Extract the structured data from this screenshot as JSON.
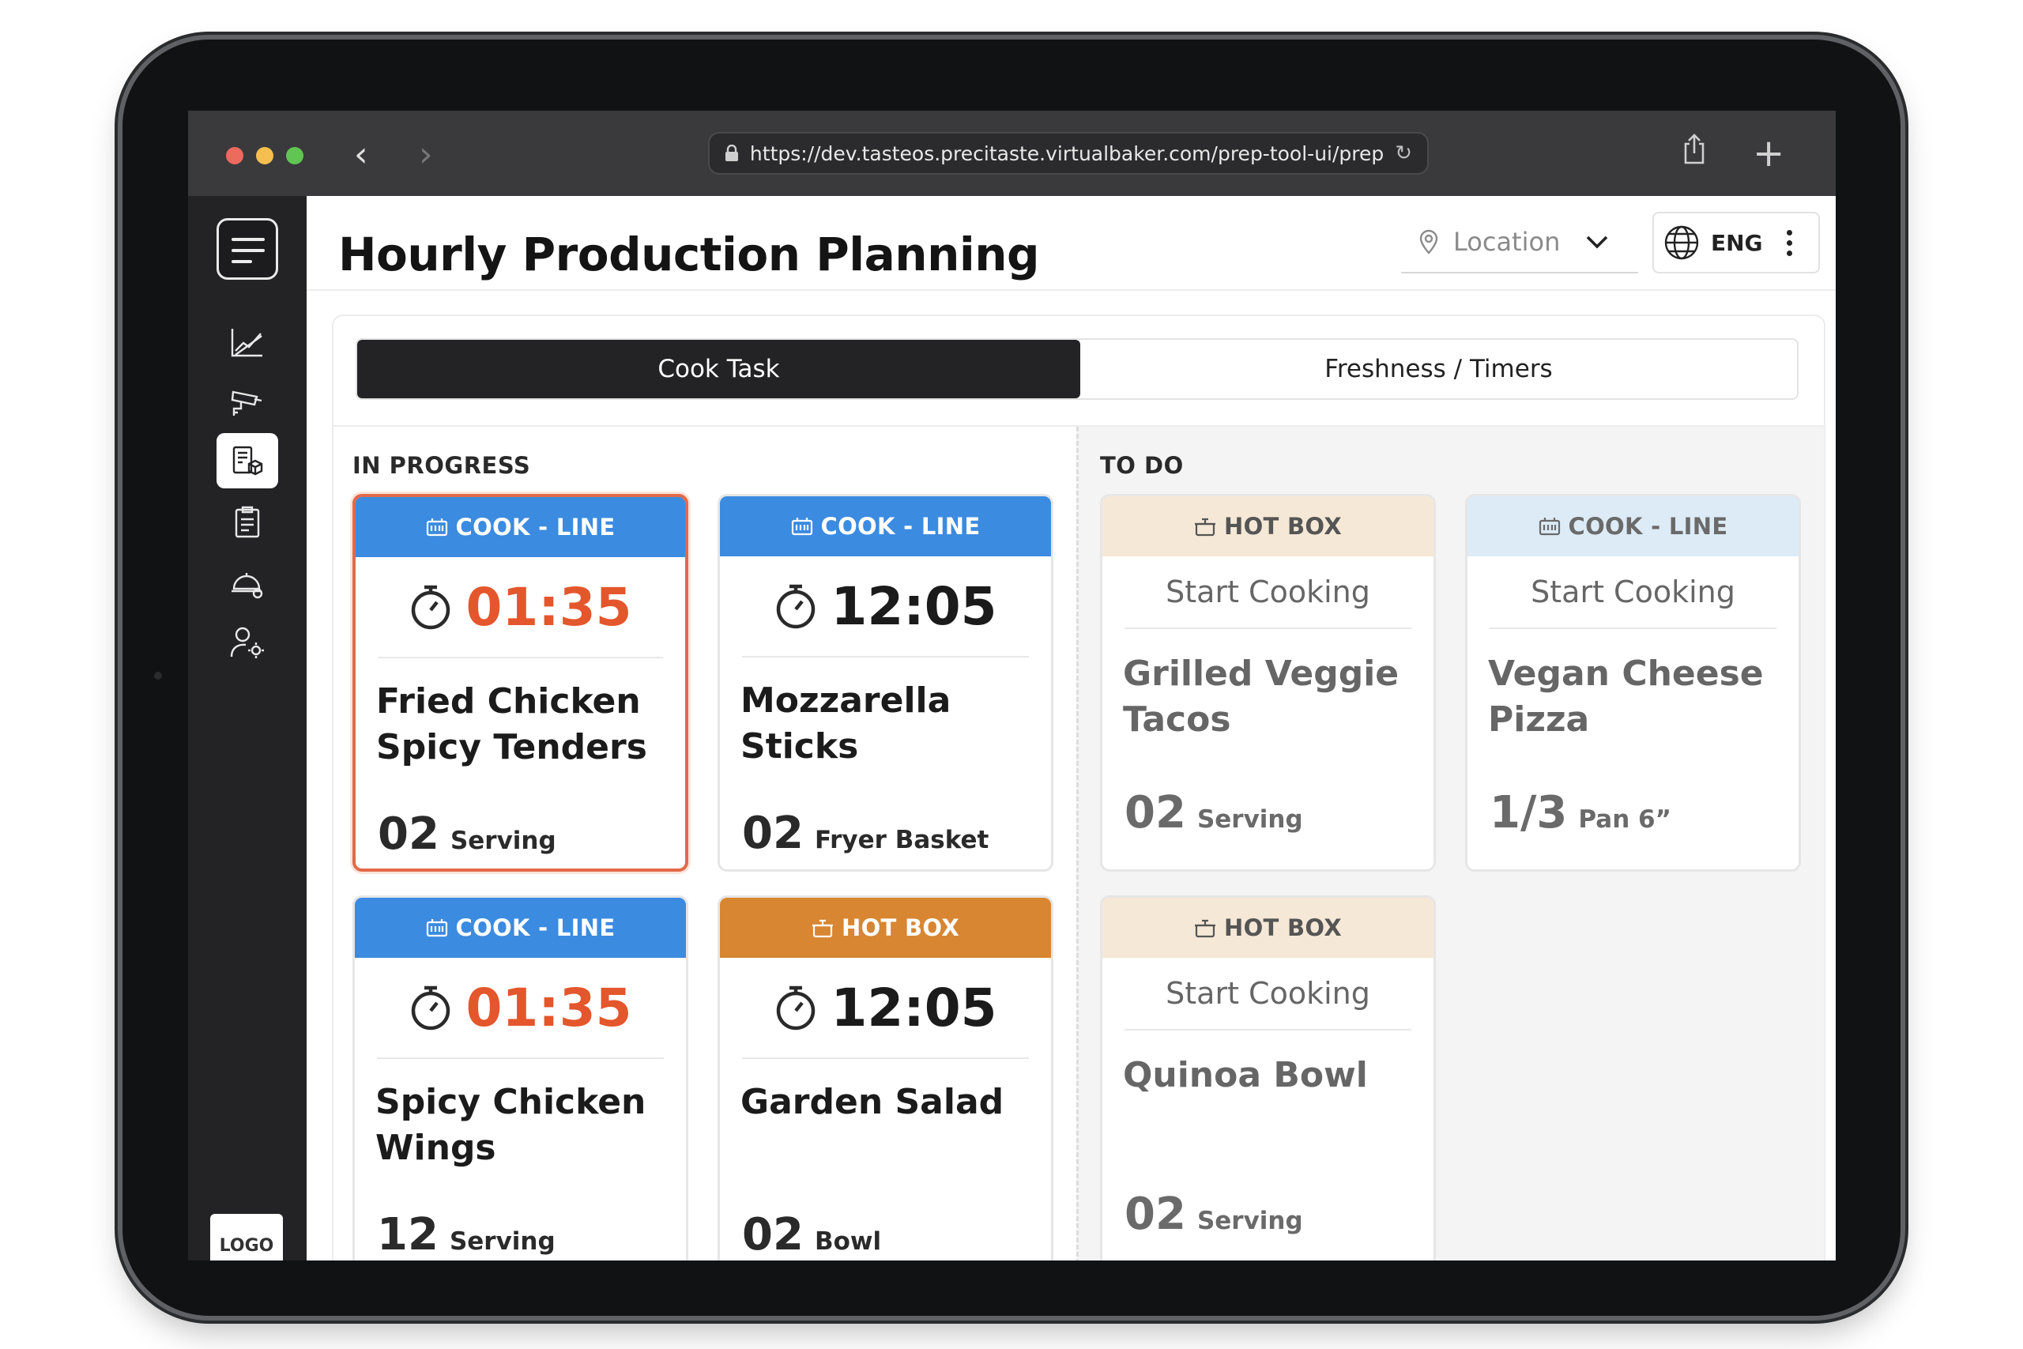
{
  "browser": {
    "url": "https://dev.tasteos.precitaste.virtualbaker.com/prep-tool-ui/prep",
    "traffic_lights": [
      "#ed6a5e",
      "#f5bf4f",
      "#61c554"
    ],
    "back": "‹",
    "forward": "›",
    "reload": "↻",
    "new_tab": "+"
  },
  "sidebar": {
    "items": [
      {
        "icon": "chart-icon"
      },
      {
        "icon": "security-camera-icon"
      },
      {
        "icon": "prep-tool-icon",
        "active": true
      },
      {
        "icon": "clipboard-icon"
      },
      {
        "icon": "service-bell-icon"
      },
      {
        "icon": "user-settings-icon"
      }
    ],
    "logo": "LOGO"
  },
  "header": {
    "title": "Hourly Production Planning",
    "location_placeholder": "Location",
    "language": "ENG"
  },
  "tabs": [
    {
      "label": "Cook Task",
      "active": true
    },
    {
      "label": "Freshness / Timers",
      "active": false
    }
  ],
  "sections": {
    "in_progress": "IN PROGRESS",
    "todo": "TO DO"
  },
  "in_progress_cards": [
    {
      "station": "COOK - LINE",
      "timer": "01:35",
      "overdue": true,
      "name_lines": [
        "Fried Chicken",
        "Spicy Tenders"
      ],
      "qty": "02",
      "unit": "Serving"
    },
    {
      "station": "COOK - LINE",
      "timer": "12:05",
      "overdue": false,
      "name_lines": [
        "Mozzarella Sticks",
        ""
      ],
      "qty": "02",
      "unit": "Fryer Basket"
    },
    {
      "station": "COOK - LINE",
      "timer": "01:35",
      "overdue": true,
      "name_lines": [
        "Spicy Chicken",
        "Wings"
      ],
      "qty": "12",
      "unit": "Serving"
    },
    {
      "station": "HOT BOX",
      "timer": "12:05",
      "overdue": false,
      "name_lines": [
        "Garden Salad",
        ""
      ],
      "qty": "02",
      "unit": "Bowl"
    }
  ],
  "todo_cards": [
    {
      "station": "HOT BOX",
      "action": "Start Cooking",
      "name_lines": [
        "Grilled Veggie",
        "Tacos"
      ],
      "qty": "02",
      "unit": "Serving"
    },
    {
      "station": "COOK - LINE",
      "action": "Start Cooking",
      "name_lines": [
        "Vegan Cheese",
        "Pizza"
      ],
      "qty": "1/3",
      "unit": "Pan 6”"
    },
    {
      "station": "HOT BOX",
      "action": "Start Cooking",
      "name_lines": [
        "Quinoa Bowl",
        ""
      ],
      "qty": "02",
      "unit": "Serving"
    }
  ],
  "colors": {
    "cook_line": "#3b8be0",
    "hot_box": "#d88632",
    "overdue_timer": "#e4562c",
    "alert_border": "#e26a47"
  }
}
